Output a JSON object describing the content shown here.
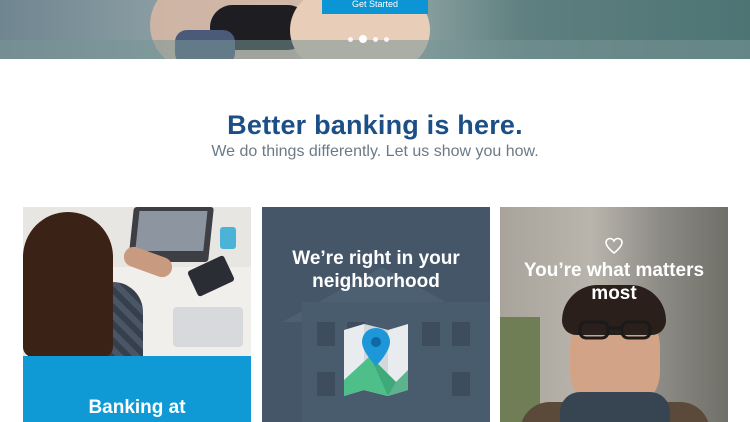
{
  "hero": {
    "cta_label": "Get Started",
    "slides_count": 4,
    "active_slide": 2
  },
  "intro": {
    "headline": "Better banking is here.",
    "subhead": "We do things differently. Let us show you how."
  },
  "cards": [
    {
      "title": "Banking at",
      "icon": "none"
    },
    {
      "title": "We’re right in your neighborhood",
      "icon": "map-icon"
    },
    {
      "title": "You’re what matters most",
      "icon": "heart-icon"
    }
  ],
  "colors": {
    "brand_blue": "#1b4f86",
    "accent_blue": "#0f9ad6",
    "subtext_gray": "#6b7a86"
  }
}
